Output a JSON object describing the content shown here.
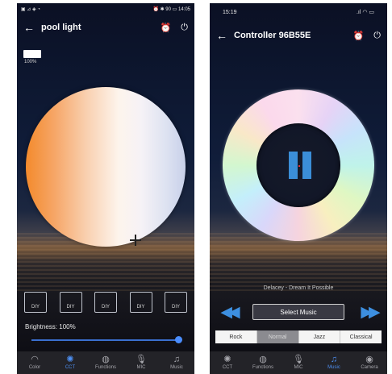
{
  "left_screen": {
    "status": {
      "left": "▣ ⊿ ◈ ◔",
      "right": "⏰ ✱ 90 ▭ 14:05"
    },
    "title": "pool light",
    "color_swatch": {
      "color": "#ffffff",
      "brightness_label": "100%"
    },
    "diy_buttons": [
      "DIY",
      "DIY",
      "DIY",
      "DIY",
      "DIY"
    ],
    "brightness_label": "Brightness: 100%",
    "brightness_value": 100,
    "nav": [
      {
        "label": "Color",
        "icon": "rainbow-icon"
      },
      {
        "label": "CCT",
        "icon": "cct-ring-icon",
        "active": true
      },
      {
        "label": "Functions",
        "icon": "stripes-ball-icon"
      },
      {
        "label": "MIC",
        "icon": "microphone-icon"
      },
      {
        "label": "Music",
        "icon": "music-note-icon"
      }
    ]
  },
  "right_screen": {
    "status": {
      "left": "15:19",
      "right": ".ıl ◠ ▭"
    },
    "title": "Controller  96B55E",
    "song": "Delacey - Dream It Possible",
    "select_music_label": "Select Music",
    "genres": [
      "Rock",
      "Normal",
      "Jazz",
      "Classical"
    ],
    "active_genre": "Normal",
    "nav": [
      {
        "label": "CCT",
        "icon": "cct-ring-icon"
      },
      {
        "label": "Functions",
        "icon": "stripes-ball-icon"
      },
      {
        "label": "MIC",
        "icon": "microphone-icon"
      },
      {
        "label": "Music",
        "icon": "music-note-icon",
        "active": true
      },
      {
        "label": "Camera",
        "icon": "camera-icon"
      }
    ]
  },
  "icons": {
    "back": "←",
    "alarm": "⏰",
    "power": "⏻",
    "rewind": "◀◀",
    "forward": "▶▶"
  },
  "colors": {
    "accent": "#3d8fe0",
    "warm": "#f38a2c",
    "cool": "#c8d0ea",
    "nav_bg": "#232328"
  }
}
